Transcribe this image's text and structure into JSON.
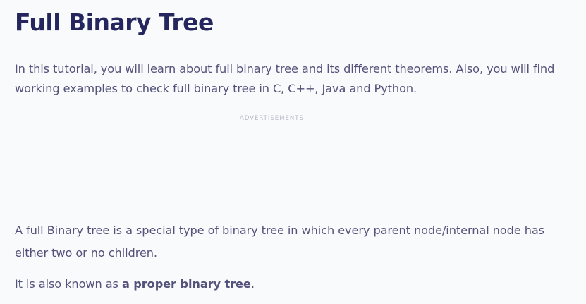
{
  "article": {
    "title": "Full Binary Tree",
    "intro": "In this tutorial, you will learn about full binary tree and its different theorems. Also, you will find working examples to check full binary tree in C, C++, Java and Python.",
    "ads_label": "ADVERTISEMENTS",
    "paragraph_1": "A full Binary tree is a special type of binary tree in which every parent node/internal node has either two or no children.",
    "paragraph_2_prefix": "It is also known as ",
    "paragraph_2_bold": "a proper binary tree",
    "paragraph_2_suffix": "."
  }
}
